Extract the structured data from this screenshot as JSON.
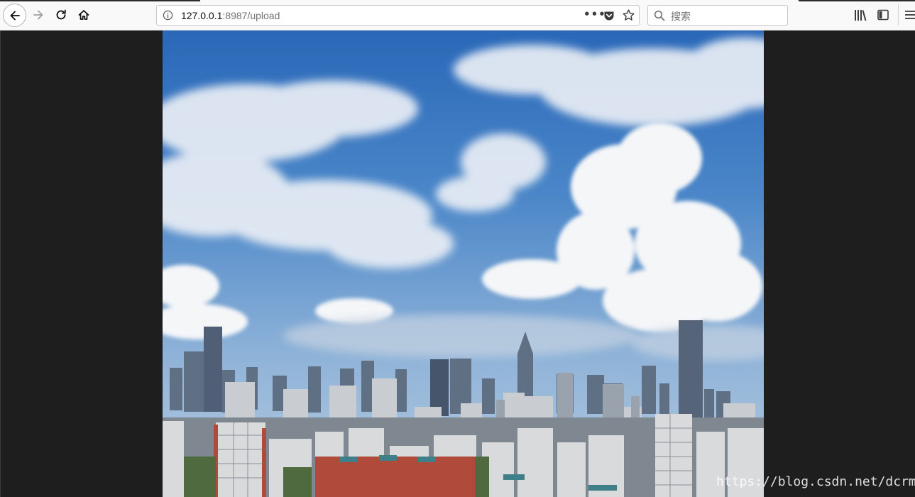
{
  "browser": {
    "url_host": "127.0.0.1",
    "url_rest": ":8987/upload",
    "search_placeholder": "搜索",
    "page_actions_label": "•••"
  },
  "content": {
    "image_alt": "",
    "watermark": "https://blog.csdn.net/dcrmg"
  },
  "icons": {
    "back": "back-arrow-icon",
    "forward": "forward-arrow-icon",
    "reload": "reload-icon",
    "home": "home-icon",
    "info": "info-icon",
    "page_actions": "more-icon",
    "pocket": "pocket-icon",
    "bookmark": "star-icon",
    "search": "search-icon",
    "library": "library-icon",
    "sidebar": "sidebar-icon",
    "menu": "hamburger-menu-icon"
  },
  "colors": {
    "toolbar_bg": "#f9f9fa",
    "page_bg": "#1e1e1e",
    "sky_top": "#2f6fbf",
    "sky_bottom": "#a9c4e0"
  }
}
